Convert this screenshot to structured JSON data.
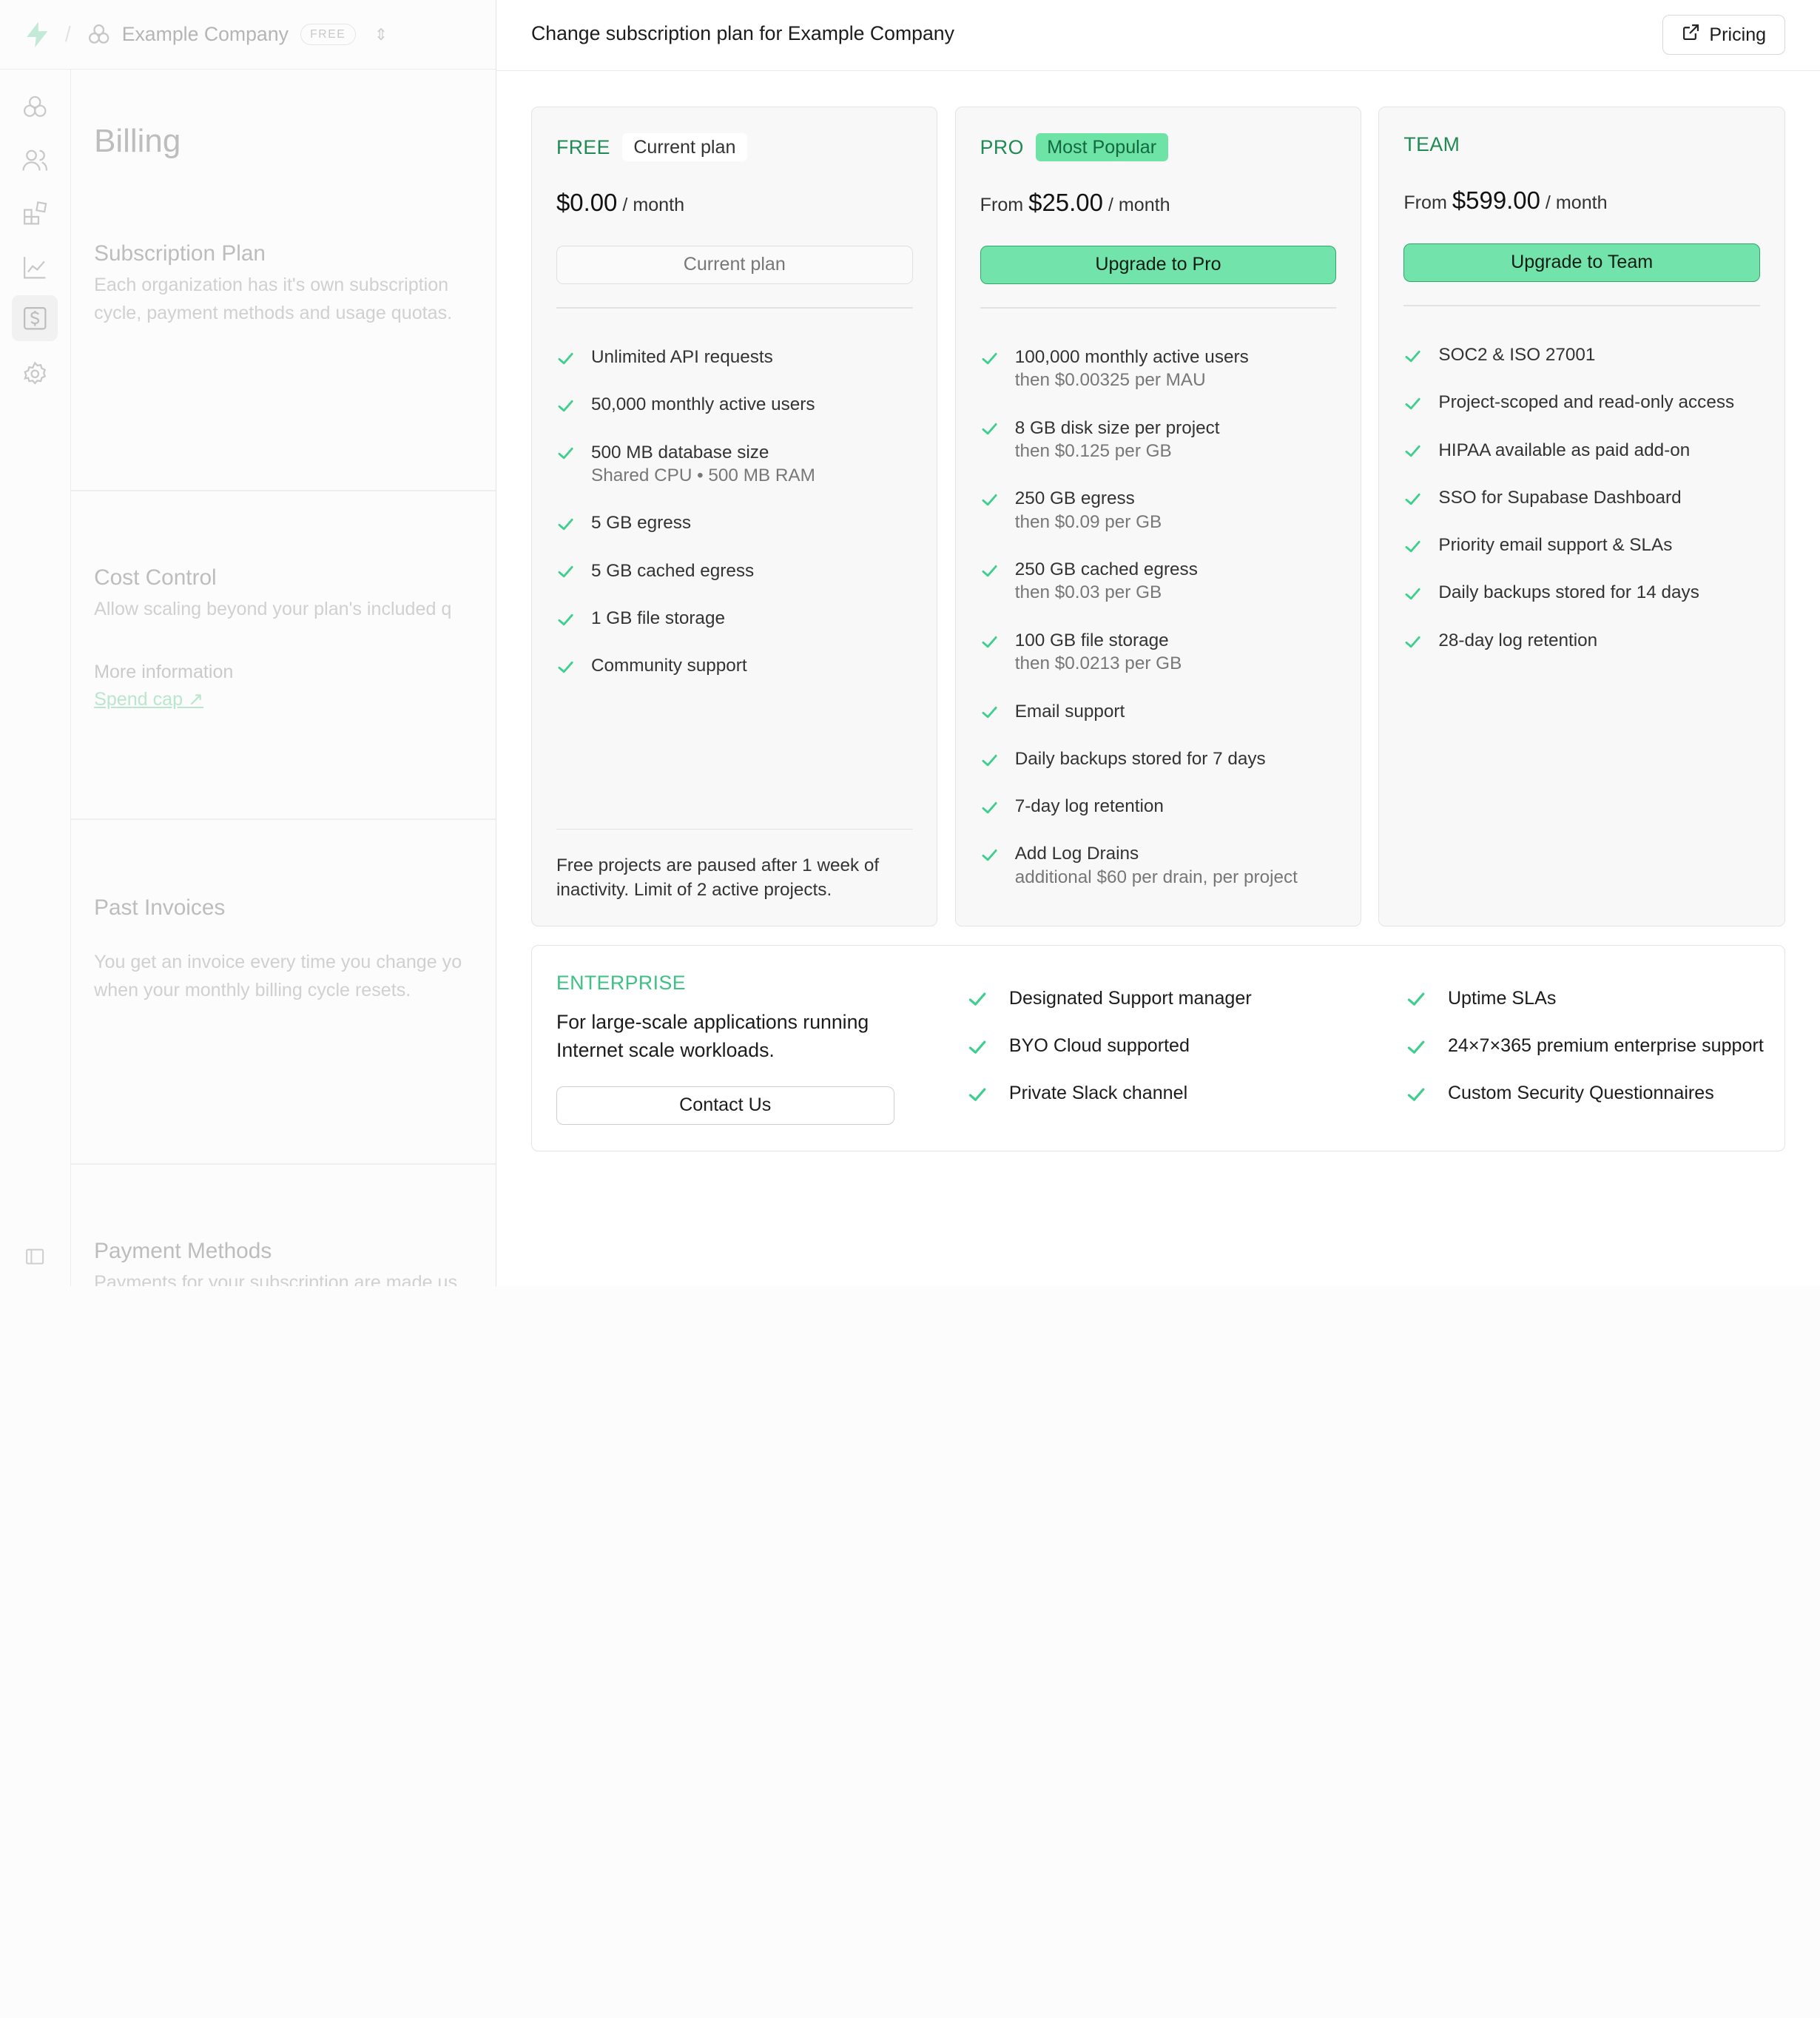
{
  "background": {
    "org_name": "Example Company",
    "org_plan_badge": "FREE",
    "page_title": "Billing",
    "sections": [
      {
        "title": "Subscription Plan",
        "lines": [
          "Each organization has it's own subscription",
          "cycle, payment methods and usage quotas."
        ]
      },
      {
        "title": "Cost Control",
        "lines": [
          "Allow scaling beyond your plan's included q"
        ],
        "more_info": "More information",
        "link": "Spend cap"
      },
      {
        "title": "Past Invoices",
        "lines": [
          "You get an invoice every time you change yo",
          "when your monthly billing cycle resets."
        ]
      },
      {
        "title": "Payment Methods",
        "lines": [
          "Payments for your subscription are made us"
        ]
      }
    ]
  },
  "panel": {
    "title": "Change subscription plan for Example Company",
    "pricing_label": "Pricing"
  },
  "plans": [
    {
      "name": "FREE",
      "badge": "Current plan",
      "price_prefix": "",
      "price": "$0.00",
      "period": "/ month",
      "button": "Current plan",
      "features": [
        {
          "text": "Unlimited API requests"
        },
        {
          "text": "50,000 monthly active users"
        },
        {
          "text": "500 MB database size",
          "sub": "Shared CPU • 500 MB RAM"
        },
        {
          "text": "5 GB egress"
        },
        {
          "text": "5 GB cached egress"
        },
        {
          "text": "1 GB file storage"
        },
        {
          "text": "Community support"
        }
      ],
      "note": "Free projects are paused after 1 week of inactivity. Limit of 2 active projects."
    },
    {
      "name": "PRO",
      "badge": "Most Popular",
      "price_prefix": "From",
      "price": "$25.00",
      "period": "/ month",
      "button": "Upgrade to Pro",
      "features": [
        {
          "text": "100,000 monthly active users",
          "sub": "then $0.00325 per MAU"
        },
        {
          "text": "8 GB disk size per project",
          "sub": "then $0.125 per GB"
        },
        {
          "text": "250 GB egress",
          "sub": "then $0.09 per GB"
        },
        {
          "text": "250 GB cached egress",
          "sub": "then $0.03 per GB"
        },
        {
          "text": "100 GB file storage",
          "sub": "then $0.0213 per GB"
        },
        {
          "text": "Email support"
        },
        {
          "text": "Daily backups stored for 7 days"
        },
        {
          "text": "7-day log retention"
        },
        {
          "text": "Add Log Drains",
          "sub": "additional $60 per drain, per project"
        }
      ]
    },
    {
      "name": "TEAM",
      "badge": "",
      "price_prefix": "From",
      "price": "$599.00",
      "period": "/ month",
      "button": "Upgrade to Team",
      "features": [
        {
          "text": "SOC2 & ISO 27001"
        },
        {
          "text": "Project-scoped and read-only access"
        },
        {
          "text": "HIPAA available as paid add-on"
        },
        {
          "text": "SSO for Supabase Dashboard"
        },
        {
          "text": "Priority email support & SLAs"
        },
        {
          "text": "Daily backups stored for 14 days"
        },
        {
          "text": "28-day log retention"
        }
      ]
    }
  ],
  "enterprise": {
    "name": "ENTERPRISE",
    "description": "For large-scale applications running Internet scale workloads.",
    "button": "Contact Us",
    "features_left": [
      "Designated Support manager",
      "BYO Cloud supported",
      "Private Slack channel"
    ],
    "features_right": [
      "Uptime SLAs",
      "24×7×365 premium enterprise support",
      "Custom Security Questionnaires"
    ]
  },
  "colors": {
    "accent": "#3ecf8e",
    "accent_text": "#1f8a56",
    "button_bg": "#72e3aa"
  }
}
